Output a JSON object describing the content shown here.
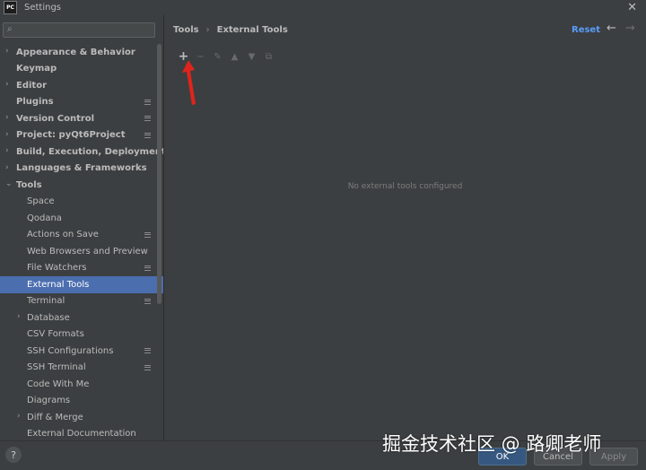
{
  "window": {
    "title": "Settings",
    "logo_text": "PC"
  },
  "search": {
    "placeholder": "",
    "value": ""
  },
  "tree": [
    {
      "label": "Appearance & Behavior",
      "level": 0,
      "expandable": true,
      "expanded": false,
      "badge": false
    },
    {
      "label": "Keymap",
      "level": 0,
      "expandable": false,
      "badge": false
    },
    {
      "label": "Editor",
      "level": 0,
      "expandable": true,
      "expanded": false,
      "badge": false
    },
    {
      "label": "Plugins",
      "level": 0,
      "expandable": false,
      "badge": true
    },
    {
      "label": "Version Control",
      "level": 0,
      "expandable": true,
      "expanded": false,
      "badge": true
    },
    {
      "label": "Project: pyQt6Project",
      "level": 0,
      "expandable": true,
      "expanded": false,
      "badge": true
    },
    {
      "label": "Build, Execution, Deployment",
      "level": 0,
      "expandable": true,
      "expanded": false,
      "badge": false
    },
    {
      "label": "Languages & Frameworks",
      "level": 0,
      "expandable": true,
      "expanded": false,
      "badge": false
    },
    {
      "label": "Tools",
      "level": 0,
      "expandable": true,
      "expanded": true,
      "badge": false
    },
    {
      "label": "Space",
      "level": 1,
      "expandable": false,
      "badge": false
    },
    {
      "label": "Qodana",
      "level": 1,
      "expandable": false,
      "badge": false
    },
    {
      "label": "Actions on Save",
      "level": 1,
      "expandable": false,
      "badge": true
    },
    {
      "label": "Web Browsers and Preview",
      "level": 1,
      "expandable": false,
      "badge": false
    },
    {
      "label": "File Watchers",
      "level": 1,
      "expandable": false,
      "badge": true
    },
    {
      "label": "External Tools",
      "level": 1,
      "expandable": false,
      "badge": false,
      "selected": true
    },
    {
      "label": "Terminal",
      "level": 1,
      "expandable": false,
      "badge": true
    },
    {
      "label": "Database",
      "level": 1,
      "expandable": true,
      "expanded": false,
      "badge": false
    },
    {
      "label": "CSV Formats",
      "level": 1,
      "expandable": false,
      "badge": false
    },
    {
      "label": "SSH Configurations",
      "level": 1,
      "expandable": false,
      "badge": true
    },
    {
      "label": "SSH Terminal",
      "level": 1,
      "expandable": false,
      "badge": true
    },
    {
      "label": "Code With Me",
      "level": 1,
      "expandable": false,
      "badge": false
    },
    {
      "label": "Diagrams",
      "level": 1,
      "expandable": false,
      "badge": false
    },
    {
      "label": "Diff & Merge",
      "level": 1,
      "expandable": true,
      "expanded": false,
      "badge": false
    },
    {
      "label": "External Documentation",
      "level": 1,
      "expandable": false,
      "badge": false
    }
  ],
  "breadcrumb": {
    "parent": "Tools",
    "current": "External Tools"
  },
  "header": {
    "reset_label": "Reset"
  },
  "toolbar": {
    "add_icon": "plus-icon",
    "remove_icon": "minus-icon",
    "edit_icon": "pencil-icon",
    "up_icon": "arrow-up-icon",
    "down_icon": "arrow-down-icon",
    "copy_icon": "copy-icon"
  },
  "content": {
    "empty_message": "No external tools configured"
  },
  "footer": {
    "ok_label": "OK",
    "cancel_label": "Cancel",
    "apply_label": "Apply",
    "help_label": "?"
  },
  "watermark": "掘金技术社区 @ 路卿老师",
  "colors": {
    "background": "#3c3f41",
    "selection": "#4b6eaf",
    "link": "#589df6",
    "annotation_arrow": "#e0241c"
  }
}
